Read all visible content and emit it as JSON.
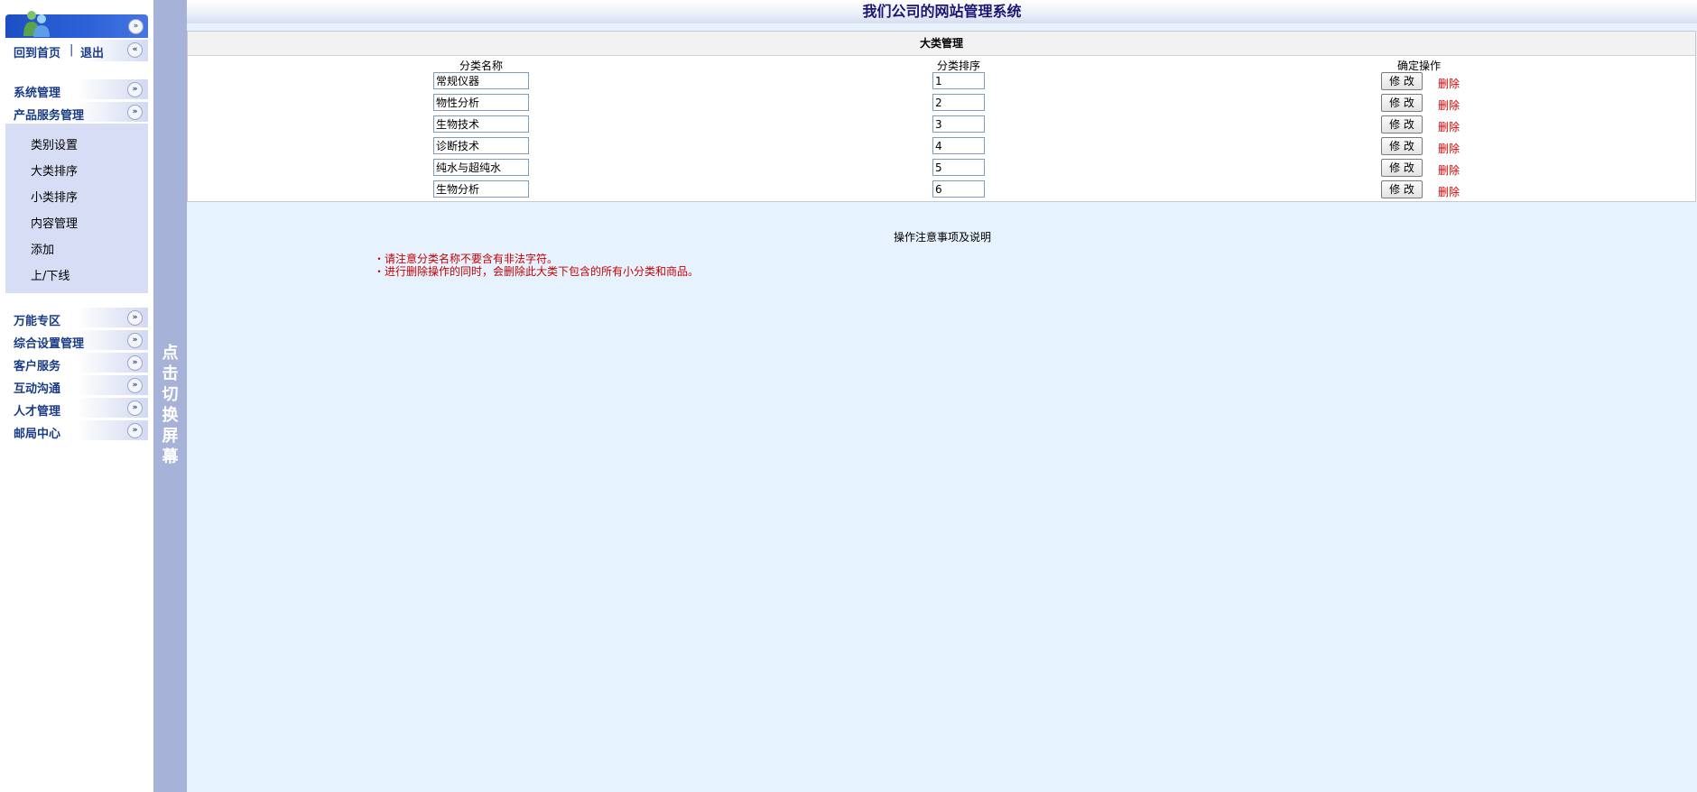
{
  "sidebar": {
    "links": {
      "home": "回到首页",
      "separator": "|",
      "logout": "退出"
    },
    "menu_top": [
      {
        "label": "系统管理"
      },
      {
        "label": "产品服务管理"
      }
    ],
    "submenu": [
      {
        "label": "类别设置"
      },
      {
        "label": "大类排序"
      },
      {
        "label": "小类排序"
      },
      {
        "label": "内容管理"
      },
      {
        "label": "添加"
      },
      {
        "label": "上/下线"
      }
    ],
    "menu_bottom": [
      {
        "label": "万能专区"
      },
      {
        "label": "综合设置管理"
      },
      {
        "label": "客户服务"
      },
      {
        "label": "互动沟通"
      },
      {
        "label": "人才管理"
      },
      {
        "label": "邮局中心"
      }
    ]
  },
  "toggle_bar": {
    "text": [
      "点",
      "击",
      "切",
      "换",
      "屏",
      "幕"
    ]
  },
  "header": {
    "title": "我们公司的网站管理系统"
  },
  "panel": {
    "title": "大类管理",
    "columns": {
      "name": "分类名称",
      "order": "分类排序",
      "action": "确定操作"
    },
    "rows": [
      {
        "name": "常规仪器",
        "order": "1"
      },
      {
        "name": "物性分析",
        "order": "2"
      },
      {
        "name": "生物技术",
        "order": "3"
      },
      {
        "name": "诊断技术",
        "order": "4"
      },
      {
        "name": "纯水与超纯水",
        "order": "5"
      },
      {
        "name": "生物分析",
        "order": "6"
      }
    ],
    "modify_label": "修 改",
    "delete_label": "删除"
  },
  "notes": {
    "title": "操作注意事项及说明",
    "lines": [
      "・请注意分类名称不要含有非法字符。",
      "・进行删除操作的同时，会删除此大类下包含的所有小分类和商品。"
    ]
  },
  "colors": {
    "sidebar_top": "#2d63d9",
    "menu_text": "#1a3c86",
    "submenu_bg": "#d6ddf5",
    "toggle_bar": "#a7b2d8",
    "main_bg": "#e6f2fe",
    "title_text": "#1a1572",
    "delete_link": "#d10000",
    "note_text": "#c40000"
  }
}
